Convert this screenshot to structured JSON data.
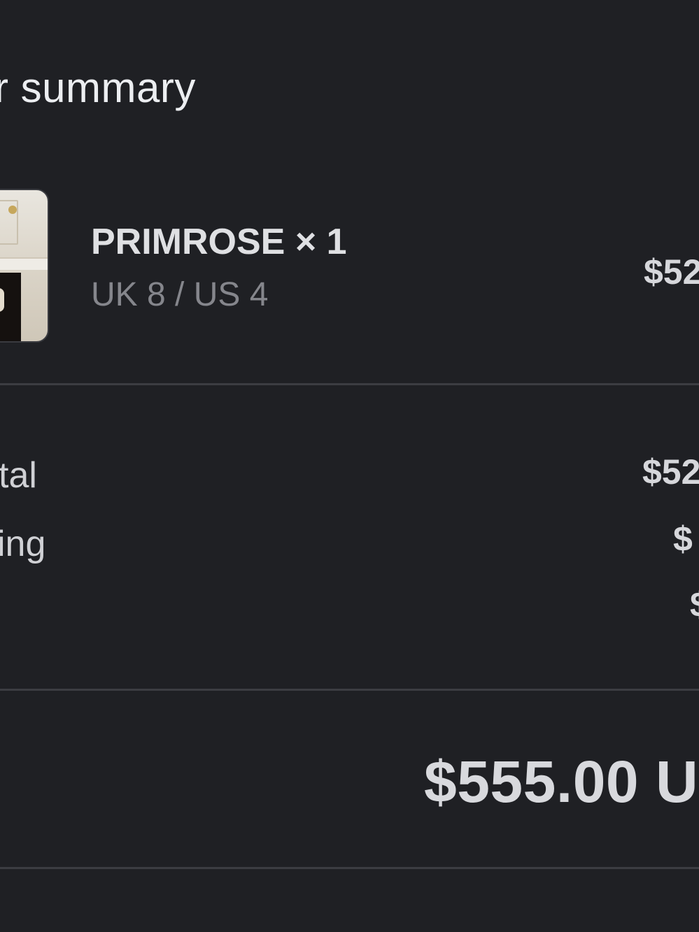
{
  "summary": {
    "title": "r summary"
  },
  "item": {
    "name": "PRIMROSE × 1",
    "variant": "UK 8 / US 4",
    "price": "$52"
  },
  "totals": {
    "subtotal_label": "tal",
    "subtotal_value": "$52",
    "shipping_label": "ing",
    "shipping_value": "$",
    "third_value": "$"
  },
  "grand_total": {
    "value": "$555.00 U"
  },
  "colors": {
    "background": "#1f2024",
    "divider": "#3c3d42",
    "text_primary": "#d6d7db",
    "text_secondary": "#85868c"
  }
}
